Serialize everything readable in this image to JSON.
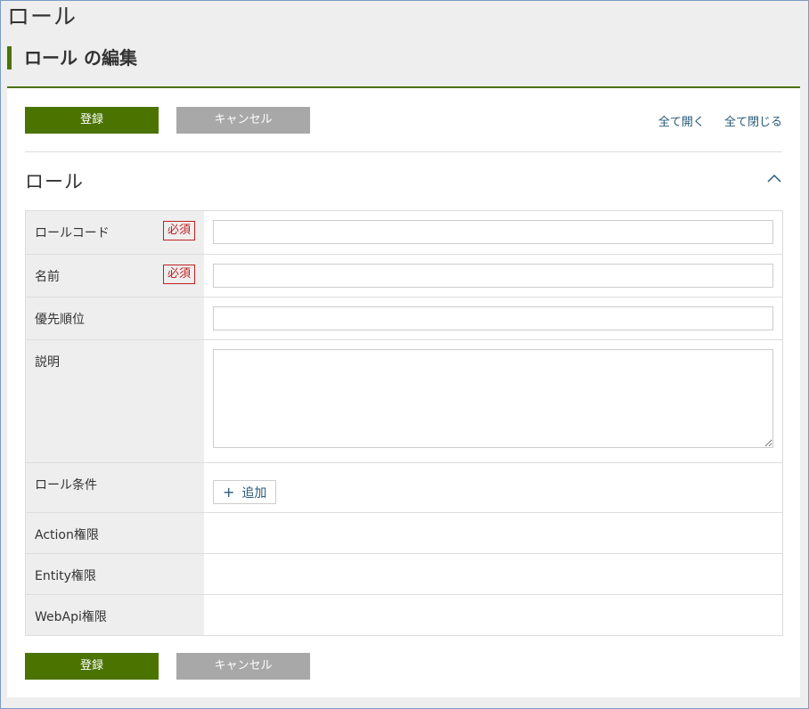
{
  "page": {
    "title": "ロール",
    "subtitle": "ロール の編集"
  },
  "toolbar": {
    "save_label": "登録",
    "cancel_label": "キャンセル",
    "expand_all": "全て開く",
    "collapse_all": "全て閉じる"
  },
  "section": {
    "title": "ロール"
  },
  "form": {
    "required_label": "必須",
    "fields": [
      {
        "label": "ロールコード",
        "required": true,
        "value": ""
      },
      {
        "label": "名前",
        "required": true,
        "value": ""
      },
      {
        "label": "優先順位",
        "required": false,
        "value": ""
      },
      {
        "label": "説明",
        "required": false,
        "value": ""
      },
      {
        "label": "ロール条件",
        "required": false
      },
      {
        "label": "Action権限",
        "required": false
      },
      {
        "label": "Entity権限",
        "required": false
      },
      {
        "label": "WebApi権限",
        "required": false
      }
    ],
    "add_label": "追加"
  },
  "colors": {
    "primary": "#4a7300",
    "cancel": "#a8a8a8",
    "link": "#2a5a7a",
    "required": "#c02020"
  }
}
